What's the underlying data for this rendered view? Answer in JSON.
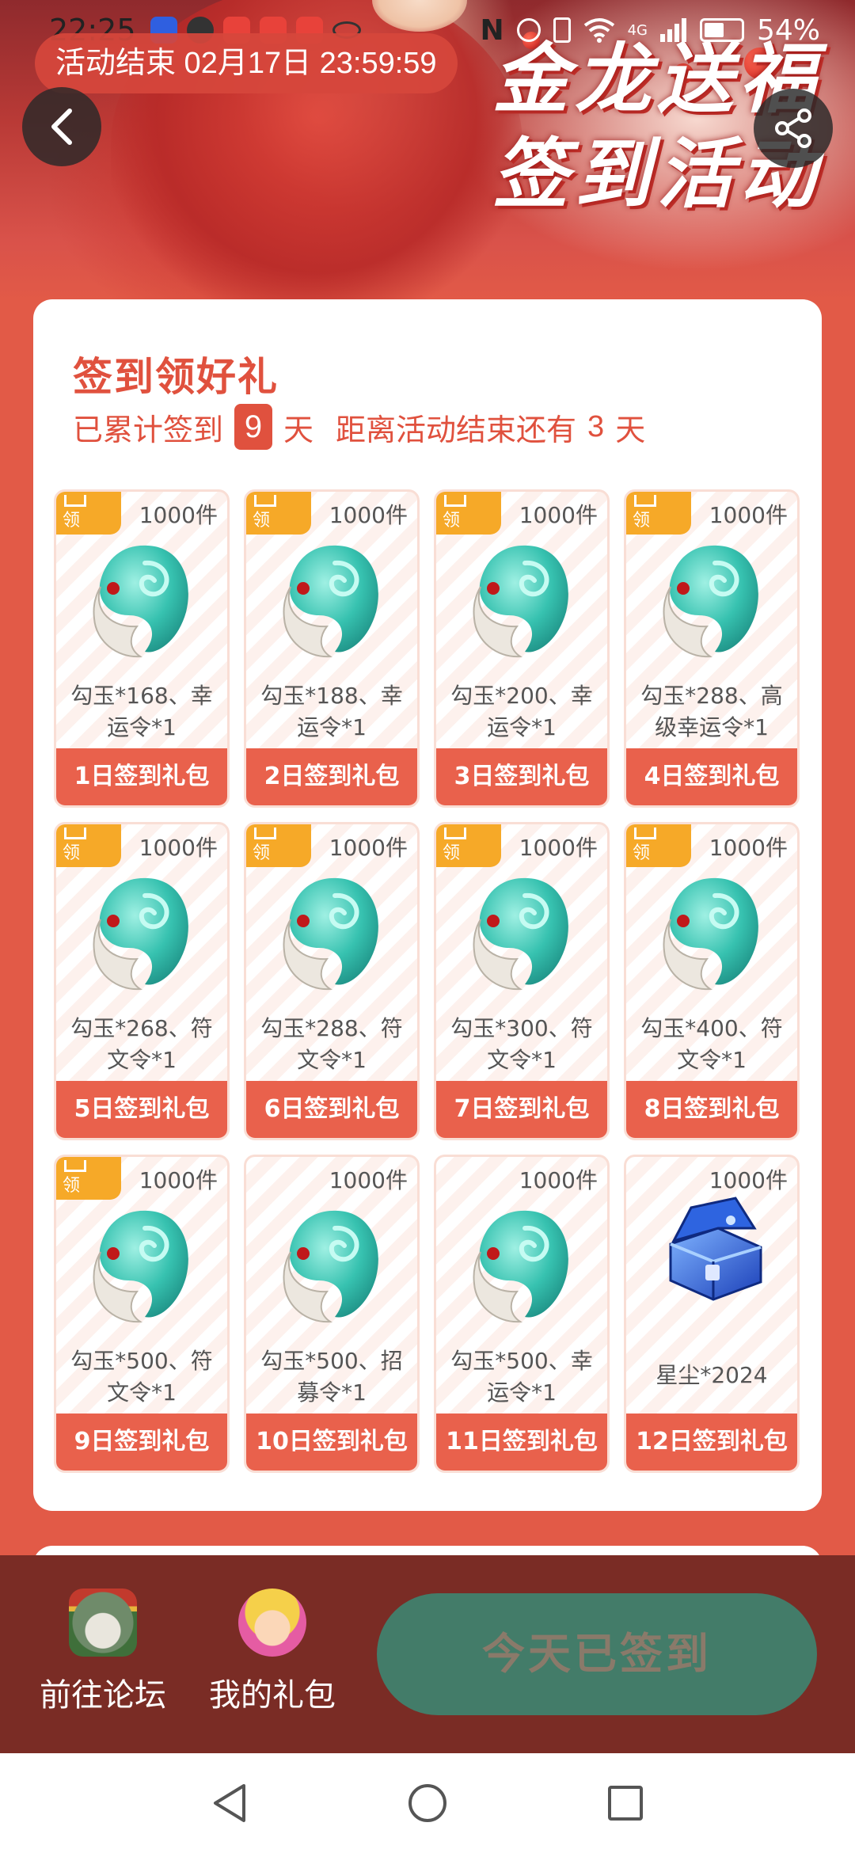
{
  "status_bar": {
    "time": "22:25",
    "battery": "54%",
    "network": "4G"
  },
  "banner": {
    "end_time": "活动结束 02月17日 23:59:59",
    "title_line1": "金龙送福",
    "title_line2": "签到活动"
  },
  "card": {
    "title": "签到领好礼",
    "sub_prefix": "已累计签到",
    "days_signed": "9",
    "sub_unit1": "天",
    "sub_remaining": "距离活动结束还有",
    "days_left": "3",
    "sub_unit2": "天"
  },
  "gifts": [
    {
      "qty": "1000件",
      "desc": "勾玉*168、幸运令*1",
      "label": "1日签到礼包",
      "claimed": true,
      "corner": "领",
      "art": "jade-icon"
    },
    {
      "qty": "1000件",
      "desc": "勾玉*188、幸运令*1",
      "label": "2日签到礼包",
      "claimed": true,
      "corner": "领",
      "art": "jade-icon"
    },
    {
      "qty": "1000件",
      "desc": "勾玉*200、幸运令*1",
      "label": "3日签到礼包",
      "claimed": true,
      "corner": "领",
      "art": "jade-icon"
    },
    {
      "qty": "1000件",
      "desc": "勾玉*288、高级幸运令*1",
      "label": "4日签到礼包",
      "claimed": true,
      "corner": "领",
      "art": "jade-icon"
    },
    {
      "qty": "1000件",
      "desc": "勾玉*268、符文令*1",
      "label": "5日签到礼包",
      "claimed": true,
      "corner": "领",
      "art": "jade-icon"
    },
    {
      "qty": "1000件",
      "desc": "勾玉*288、符文令*1",
      "label": "6日签到礼包",
      "claimed": true,
      "corner": "领",
      "art": "jade-icon"
    },
    {
      "qty": "1000件",
      "desc": "勾玉*300、符文令*1",
      "label": "7日签到礼包",
      "claimed": true,
      "corner": "领",
      "art": "jade-icon"
    },
    {
      "qty": "1000件",
      "desc": "勾玉*400、符文令*1",
      "label": "8日签到礼包",
      "claimed": true,
      "corner": "领",
      "art": "jade-icon"
    },
    {
      "qty": "1000件",
      "desc": "勾玉*500、符文令*1",
      "label": "9日签到礼包",
      "claimed": true,
      "corner": "领",
      "art": "jade-icon"
    },
    {
      "qty": "1000件",
      "desc": "勾玉*500、招募令*1",
      "label": "10日签到礼包",
      "claimed": false,
      "corner": "",
      "art": "jade-icon"
    },
    {
      "qty": "1000件",
      "desc": "勾玉*500、幸运令*1",
      "label": "11日签到礼包",
      "claimed": false,
      "corner": "",
      "art": "jade-icon"
    },
    {
      "qty": "1000件",
      "desc": "星尘*2024",
      "label": "12日签到礼包",
      "claimed": false,
      "corner": "",
      "art": "treasure-chest-icon"
    }
  ],
  "action_bar": {
    "forum_label": "前往论坛",
    "my_gifts_label": "我的礼包",
    "signed_label": "今天已签到"
  },
  "colors": {
    "accent": "#e0513e",
    "page_bg": "#e25a47",
    "bar_bg": "#7a2c25",
    "signed_btn": "#437c69",
    "corner_badge": "#f6a928"
  }
}
